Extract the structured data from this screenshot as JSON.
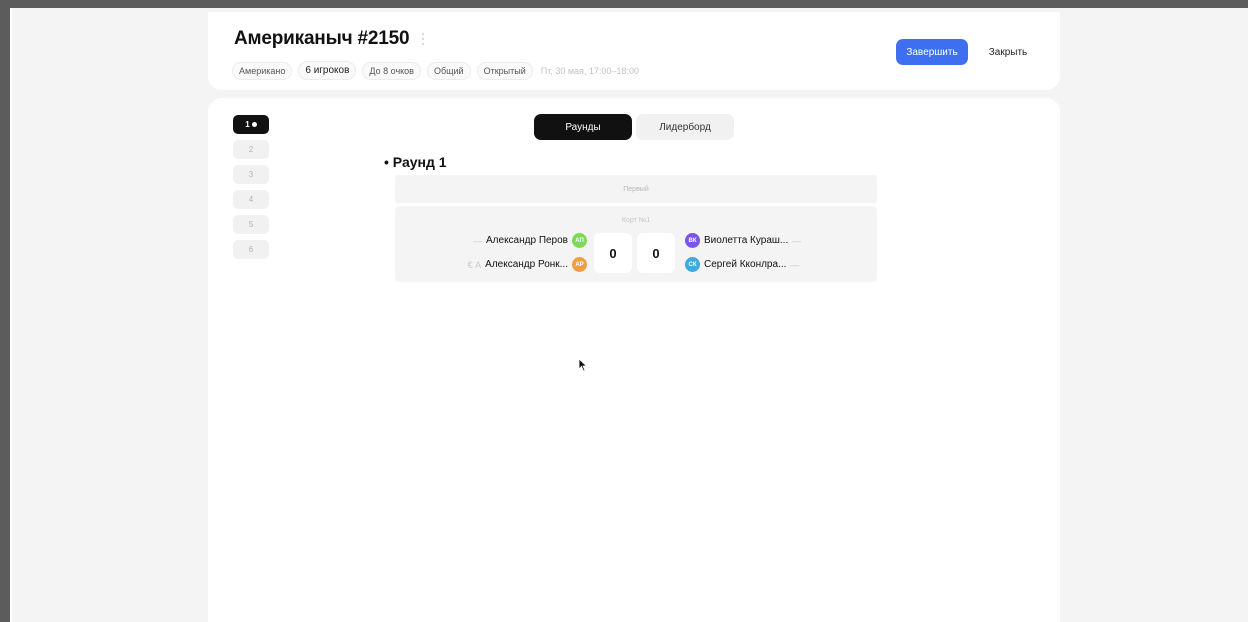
{
  "game": {
    "title": "Американыч #2150",
    "chips": [
      "Американо",
      "6 игроков",
      "До 8 очков",
      "Общий",
      "Открытый"
    ],
    "date": "Пт, 30 мая, 17:00–18:00"
  },
  "actions": {
    "finish": "Завершить",
    "close": "Закрыть"
  },
  "round_nav": {
    "active": "1",
    "items": [
      "2",
      "3",
      "4",
      "5",
      "6"
    ]
  },
  "tabs": [
    "Раунды",
    "Лидерборд"
  ],
  "round": {
    "title": "• Раунд 1",
    "court_header": "Первый",
    "court_label": "Корт №1",
    "team_a": [
      {
        "mark": "—",
        "name": "Александр Перов",
        "initials": "АП",
        "color": "#7ed957"
      },
      {
        "mark": "€ А",
        "name": "Александр Ронк...",
        "initials": "АР",
        "color": "#f0a040"
      }
    ],
    "team_b": [
      {
        "mark": "—",
        "name": "Виолетта Кураш...",
        "initials": "ВК",
        "color": "#7b55e6"
      },
      {
        "mark": "—",
        "name": "Сергей Кконлра...",
        "initials": "СК",
        "color": "#3fa9e0"
      }
    ],
    "score_a": "0",
    "score_b": "0"
  }
}
